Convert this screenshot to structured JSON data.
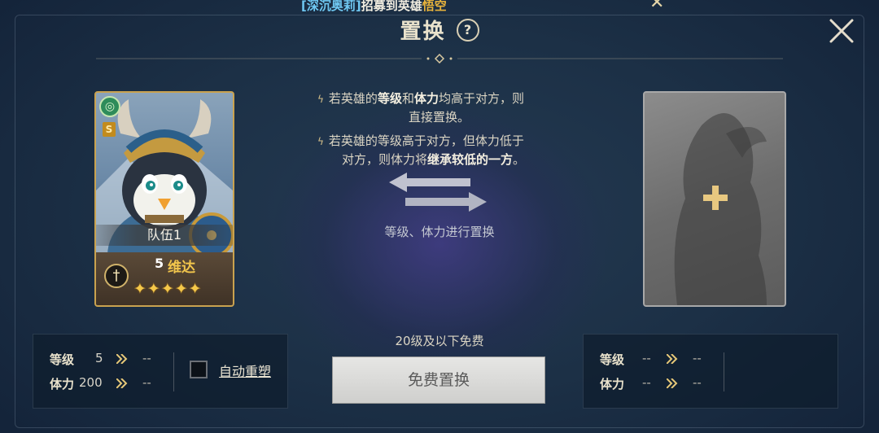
{
  "notice": {
    "prefix": "[深沉奥莉]",
    "middle": "招募到英雄",
    "hero": "悟空"
  },
  "header": {
    "title": "置换",
    "help_symbol": "?"
  },
  "hero_card": {
    "team": "队伍1",
    "level": "5",
    "name": "维达",
    "rank": "S",
    "stars": "✦✦✦✦✦",
    "star_count": 5
  },
  "rules": {
    "rule1_a": "若英雄的",
    "rule1_b": "等级",
    "rule1_c": "和",
    "rule1_d": "体力",
    "rule1_e": "均高于对方，则",
    "rule1_l2": "直接置换。",
    "rule2_l1": "若英雄的等级高于对方，但体力低于",
    "rule2_l2a": "对方，则体力将",
    "rule2_l2b": "继承较低的一方",
    "rule2_l2c": "。"
  },
  "swap_caption": "等级、体力进行置换",
  "left_stats": {
    "level_label": "等级",
    "level_value": "5",
    "level_new": "--",
    "stamina_label": "体力",
    "stamina_value": "200",
    "stamina_new": "--"
  },
  "auto_reshape": {
    "label": "自动重塑",
    "checked": false
  },
  "right_stats": {
    "level_label": "等级",
    "level_value": "--",
    "level_new": "--",
    "stamina_label": "体力",
    "stamina_value": "--",
    "stamina_new": "--"
  },
  "free_note": "20级及以下免费",
  "free_button": "免费置换",
  "colors": {
    "gold": "#e9b43c",
    "accent_blue": "#6fc8f2",
    "hero_name": "#f2c64c"
  }
}
